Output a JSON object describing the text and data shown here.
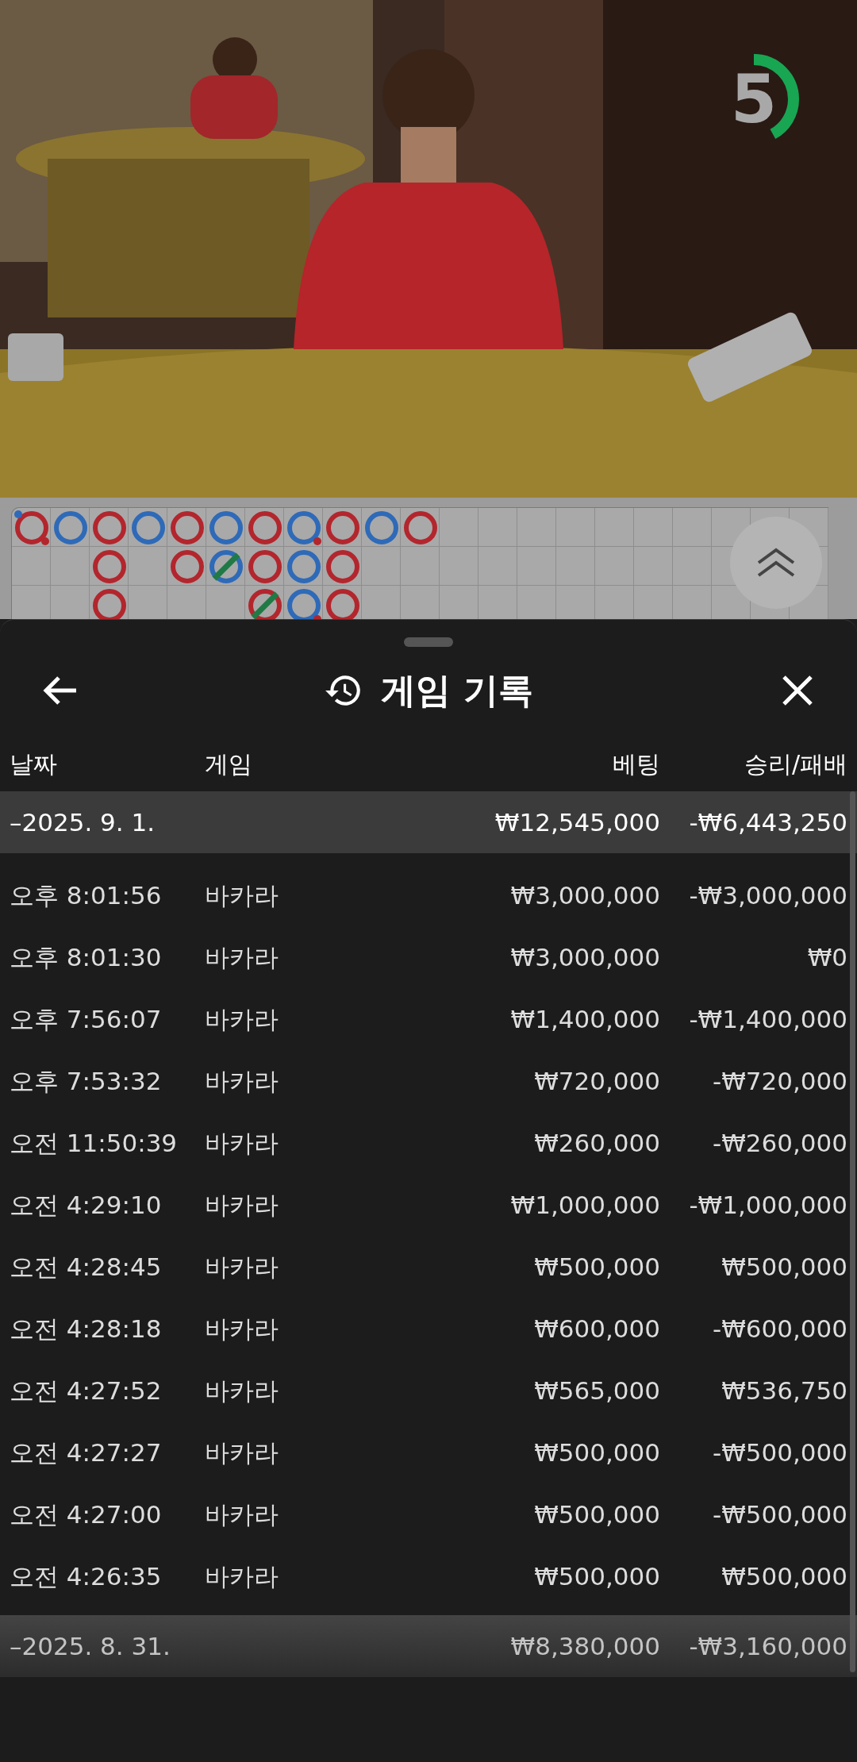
{
  "video": {
    "kind": "picture",
    "countdown": {
      "value": "5",
      "level": 0.42
    }
  },
  "roadmap": {
    "columns": [
      [
        {
          "color": "#b3262d",
          "tie": false,
          "player_pair": true,
          "banker_pair": true
        }
      ],
      [
        {
          "color": "#2e6ab8",
          "tie": false,
          "player_pair": false,
          "banker_pair": false
        }
      ],
      [
        {
          "color": "#b3262d",
          "tie": false,
          "player_pair": false,
          "banker_pair": false
        },
        {
          "color": "#b3262d",
          "tie": false,
          "player_pair": false,
          "banker_pair": false
        },
        {
          "color": "#b3262d",
          "tie": false,
          "player_pair": false,
          "banker_pair": false
        }
      ],
      [
        {
          "color": "#2e6ab8",
          "tie": false,
          "player_pair": false,
          "banker_pair": false
        }
      ],
      [
        {
          "color": "#b3262d",
          "tie": false,
          "player_pair": false,
          "banker_pair": false
        },
        {
          "color": "#b3262d",
          "tie": false,
          "player_pair": false,
          "banker_pair": false
        }
      ],
      [
        {
          "color": "#2e6ab8",
          "tie": false,
          "player_pair": false,
          "banker_pair": false
        },
        {
          "color": "#2e6ab8",
          "tie": true,
          "player_pair": false,
          "banker_pair": false
        }
      ],
      [
        {
          "color": "#b3262d",
          "tie": false,
          "player_pair": false,
          "banker_pair": false
        },
        {
          "color": "#b3262d",
          "tie": false,
          "player_pair": false,
          "banker_pair": false
        },
        {
          "color": "#b3262d",
          "tie": true,
          "player_pair": false,
          "banker_pair": false
        }
      ],
      [
        {
          "color": "#2e6ab8",
          "tie": false,
          "player_pair": false,
          "banker_pair": true
        },
        {
          "color": "#2e6ab8",
          "tie": false,
          "player_pair": false,
          "banker_pair": false
        },
        {
          "color": "#2e6ab8",
          "tie": false,
          "player_pair": false,
          "banker_pair": true
        }
      ],
      [
        {
          "color": "#b3262d",
          "tie": false,
          "player_pair": false,
          "banker_pair": false
        },
        {
          "color": "#b3262d",
          "tie": false,
          "player_pair": false,
          "banker_pair": false
        },
        {
          "color": "#b3262d",
          "tie": false,
          "player_pair": false,
          "banker_pair": false
        }
      ],
      [
        {
          "color": "#2e6ab8",
          "tie": false,
          "player_pair": false,
          "banker_pair": false
        }
      ],
      [
        {
          "color": "#b3262d",
          "tie": false,
          "player_pair": false,
          "banker_pair": false
        }
      ]
    ]
  },
  "sheet": {
    "title": "게임 기록",
    "columns": [
      "날짜",
      "게임",
      "베팅",
      "승리/패배"
    ],
    "groups": [
      {
        "date": "–2025. 9. 1.",
        "bet": "₩12,545,000",
        "result": "-₩6,443,250",
        "rows": [
          {
            "time": "오후 8:01:56",
            "game": "바카라",
            "bet": "₩3,000,000",
            "result": "-₩3,000,000"
          },
          {
            "time": "오후 8:01:30",
            "game": "바카라",
            "bet": "₩3,000,000",
            "result": "₩0"
          },
          {
            "time": "오후 7:56:07",
            "game": "바카라",
            "bet": "₩1,400,000",
            "result": "-₩1,400,000"
          },
          {
            "time": "오후 7:53:32",
            "game": "바카라",
            "bet": "₩720,000",
            "result": "-₩720,000"
          },
          {
            "time": "오전 11:50:39",
            "game": "바카라",
            "bet": "₩260,000",
            "result": "-₩260,000"
          },
          {
            "time": "오전 4:29:10",
            "game": "바카라",
            "bet": "₩1,000,000",
            "result": "-₩1,000,000"
          },
          {
            "time": "오전 4:28:45",
            "game": "바카라",
            "bet": "₩500,000",
            "result": "₩500,000"
          },
          {
            "time": "오전 4:28:18",
            "game": "바카라",
            "bet": "₩600,000",
            "result": "-₩600,000"
          },
          {
            "time": "오전 4:27:52",
            "game": "바카라",
            "bet": "₩565,000",
            "result": "₩536,750"
          },
          {
            "time": "오전 4:27:27",
            "game": "바카라",
            "bet": "₩500,000",
            "result": "-₩500,000"
          },
          {
            "time": "오전 4:27:00",
            "game": "바카라",
            "bet": "₩500,000",
            "result": "-₩500,000"
          },
          {
            "time": "오전 4:26:35",
            "game": "바카라",
            "bet": "₩500,000",
            "result": "₩500,000"
          }
        ]
      },
      {
        "date": "–2025. 8. 31.",
        "bet": "₩8,380,000",
        "result": "-₩3,160,000"
      }
    ]
  }
}
